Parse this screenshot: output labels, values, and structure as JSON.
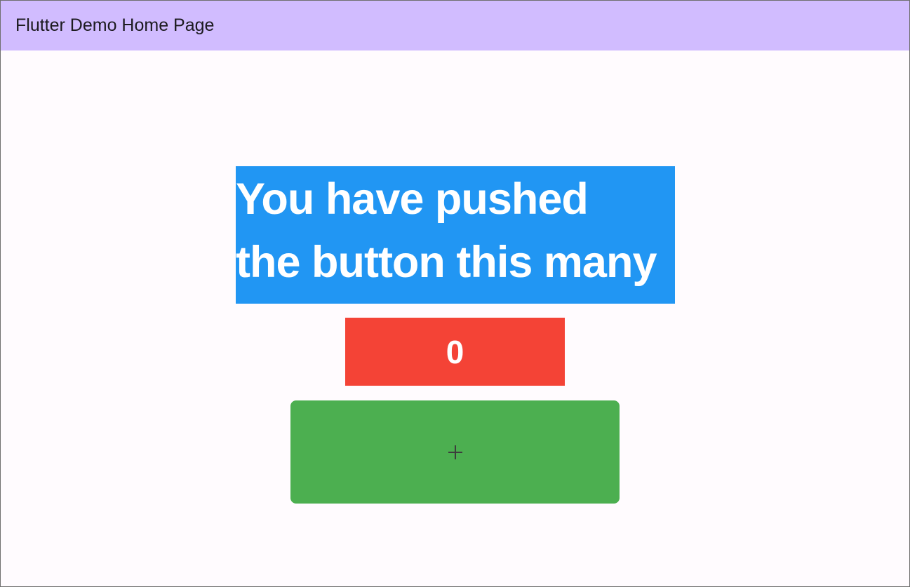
{
  "app_bar": {
    "title": "Flutter Demo Home Page"
  },
  "main": {
    "message": "You have pushed the button this many",
    "counter": "0",
    "increment_button": {
      "icon": "plus-icon"
    }
  },
  "colors": {
    "app_bar": "#d1bcff",
    "background": "#fffbfe",
    "message_box": "#2196f3",
    "counter_box": "#f44336",
    "button": "#4caf50"
  }
}
